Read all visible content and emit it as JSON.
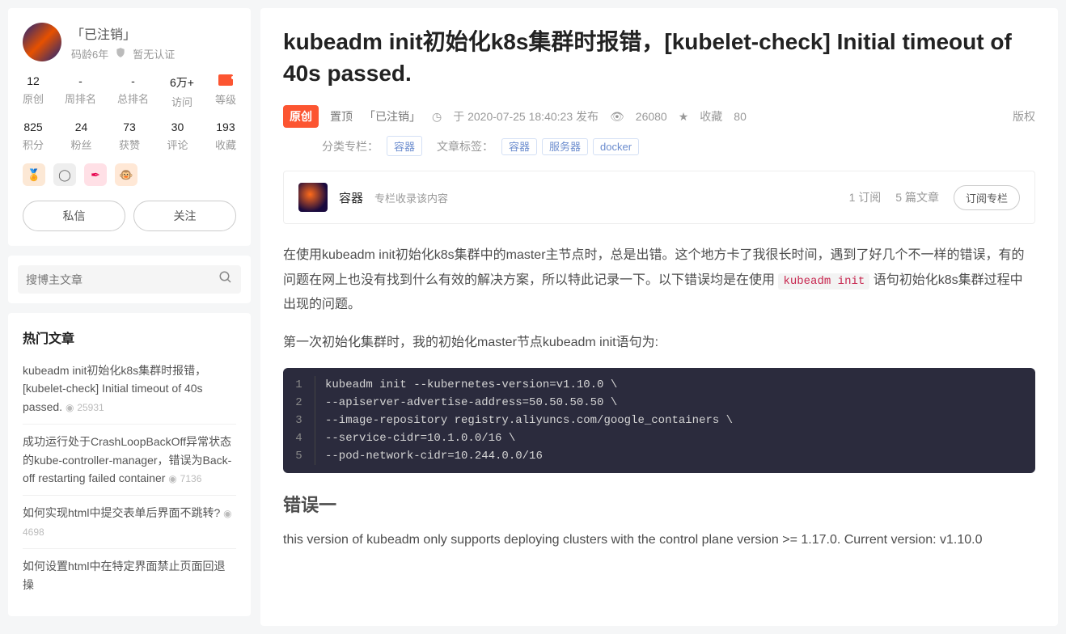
{
  "sidebar": {
    "profile": {
      "name": "「已注销」",
      "age_label": "码龄6年",
      "cert_label": "暂无认证"
    },
    "stats1": [
      {
        "val": "12",
        "label": "原创"
      },
      {
        "val": "-",
        "label": "周排名"
      },
      {
        "val": "-",
        "label": "总排名"
      },
      {
        "val": "6万+",
        "label": "访问"
      },
      {
        "val": "",
        "label": "等级"
      }
    ],
    "stats2": [
      {
        "val": "825",
        "label": "积分"
      },
      {
        "val": "24",
        "label": "粉丝"
      },
      {
        "val": "73",
        "label": "获赞"
      },
      {
        "val": "30",
        "label": "评论"
      },
      {
        "val": "193",
        "label": "收藏"
      }
    ],
    "btn_msg": "私信",
    "btn_follow": "关注",
    "search_placeholder": "搜博主文章",
    "hot_title": "热门文章",
    "hot_items": [
      {
        "title": "kubeadm init初始化k8s集群时报错，[kubelet-check] Initial timeout of 40s passed.",
        "views": "25931"
      },
      {
        "title": "成功运行处于CrashLoopBackOff异常状态的kube-controller-manager，错误为Back-off restarting failed container",
        "views": "7136"
      },
      {
        "title": "如何实现html中提交表单后界面不跳转?",
        "views": "4698"
      },
      {
        "title": "如何设置html中在特定界面禁止页面回退操",
        "views": ""
      }
    ]
  },
  "article": {
    "title": "kubeadm init初始化k8s集群时报错，[kubelet-check] Initial timeout of 40s passed.",
    "badge": "原创",
    "pin": "置顶",
    "author": "「已注销」",
    "time": "于 2020-07-25 18:40:23 发布",
    "views": "26080",
    "fav_label": "收藏",
    "fav_count": "80",
    "copyright": "版权",
    "category_label": "分类专栏：",
    "category": "容器",
    "tag_label": "文章标签：",
    "tags": [
      "容器",
      "服务器",
      "docker"
    ],
    "column": {
      "name": "容器",
      "desc": "专栏收录该内容",
      "subs": "1 订阅",
      "count": "5 篇文章",
      "btn": "订阅专栏"
    },
    "intro_before": "在使用kubeadm init初始化k8s集群中的master主节点时，总是出错。这个地方卡了我很长时间，遇到了好几个不一样的错误，有的问题在网上也没有找到什么有效的解决方案，所以特此记录一下。以下错误均是在使用 ",
    "intro_code": "kubeadm init",
    "intro_after": " 语句初始化k8s集群过程中出现的问题。",
    "p2": "第一次初始化集群时，我的初始化master节点kubeadm init语句为:",
    "code_lines": [
      "kubeadm init --kubernetes-version=v1.10.0 \\",
      "--apiserver-advertise-address=50.50.50.50 \\",
      "--image-repository registry.aliyuncs.com/google_containers \\",
      "--service-cidr=10.1.0.0/16 \\",
      "--pod-network-cidr=10.244.0.0/16"
    ],
    "err_heading": "错误一",
    "err_text": "this version of kubeadm only supports deploying clusters with the control plane version >= 1.17.0. Current version: v1.10.0"
  }
}
